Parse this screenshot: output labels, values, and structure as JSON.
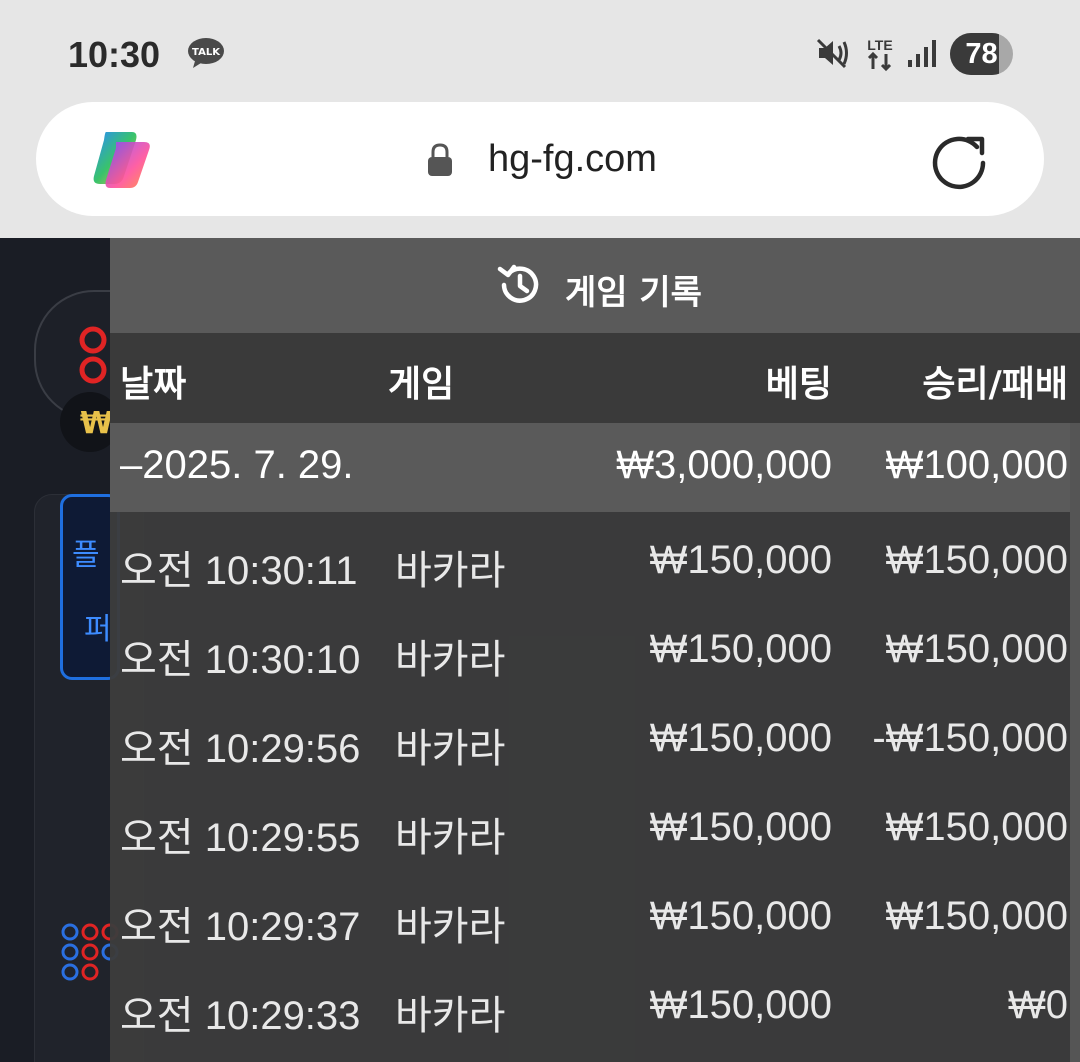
{
  "status_bar": {
    "time": "10:30",
    "talk_badge": "TALK",
    "network": "LTE",
    "battery_level": "78",
    "battery_fraction": 0.78
  },
  "browser": {
    "url": "hg-fg.com",
    "logo_icon": "copilot-logo",
    "lock_icon": "lock-icon",
    "reload_icon": "reload-icon"
  },
  "history": {
    "title": "게임 기록",
    "columns": {
      "date": "날짜",
      "game": "게임",
      "bet": "베팅",
      "result": "승리/패배"
    },
    "group": {
      "date": "–2025. 7. 29.",
      "bet": "₩3,000,000",
      "result": "₩100,000"
    },
    "rows": [
      {
        "time": "오전 10:30:11",
        "game": "바카라",
        "bet": "₩150,000",
        "result": "₩150,000"
      },
      {
        "time": "오전 10:30:10",
        "game": "바카라",
        "bet": "₩150,000",
        "result": "₩150,000"
      },
      {
        "time": "오전 10:29:56",
        "game": "바카라",
        "bet": "₩150,000",
        "result": "-₩150,000"
      },
      {
        "time": "오전 10:29:55",
        "game": "바카라",
        "bet": "₩150,000",
        "result": "₩150,000"
      },
      {
        "time": "오전 10:29:37",
        "game": "바카라",
        "bet": "₩150,000",
        "result": "₩150,000"
      },
      {
        "time": "오전 10:29:33",
        "game": "바카라",
        "bet": "₩150,000",
        "result": "₩0"
      }
    ]
  },
  "background": {
    "won_symbol": "₩",
    "blue_card_line1": "플",
    "blue_card_line2": "퍼"
  },
  "colors": {
    "overlay": "#3c3c3c",
    "header": "#5a5a5a",
    "accent_blue": "#1f6fe0",
    "accent_red": "#e02424",
    "gold": "#e8c14a"
  }
}
